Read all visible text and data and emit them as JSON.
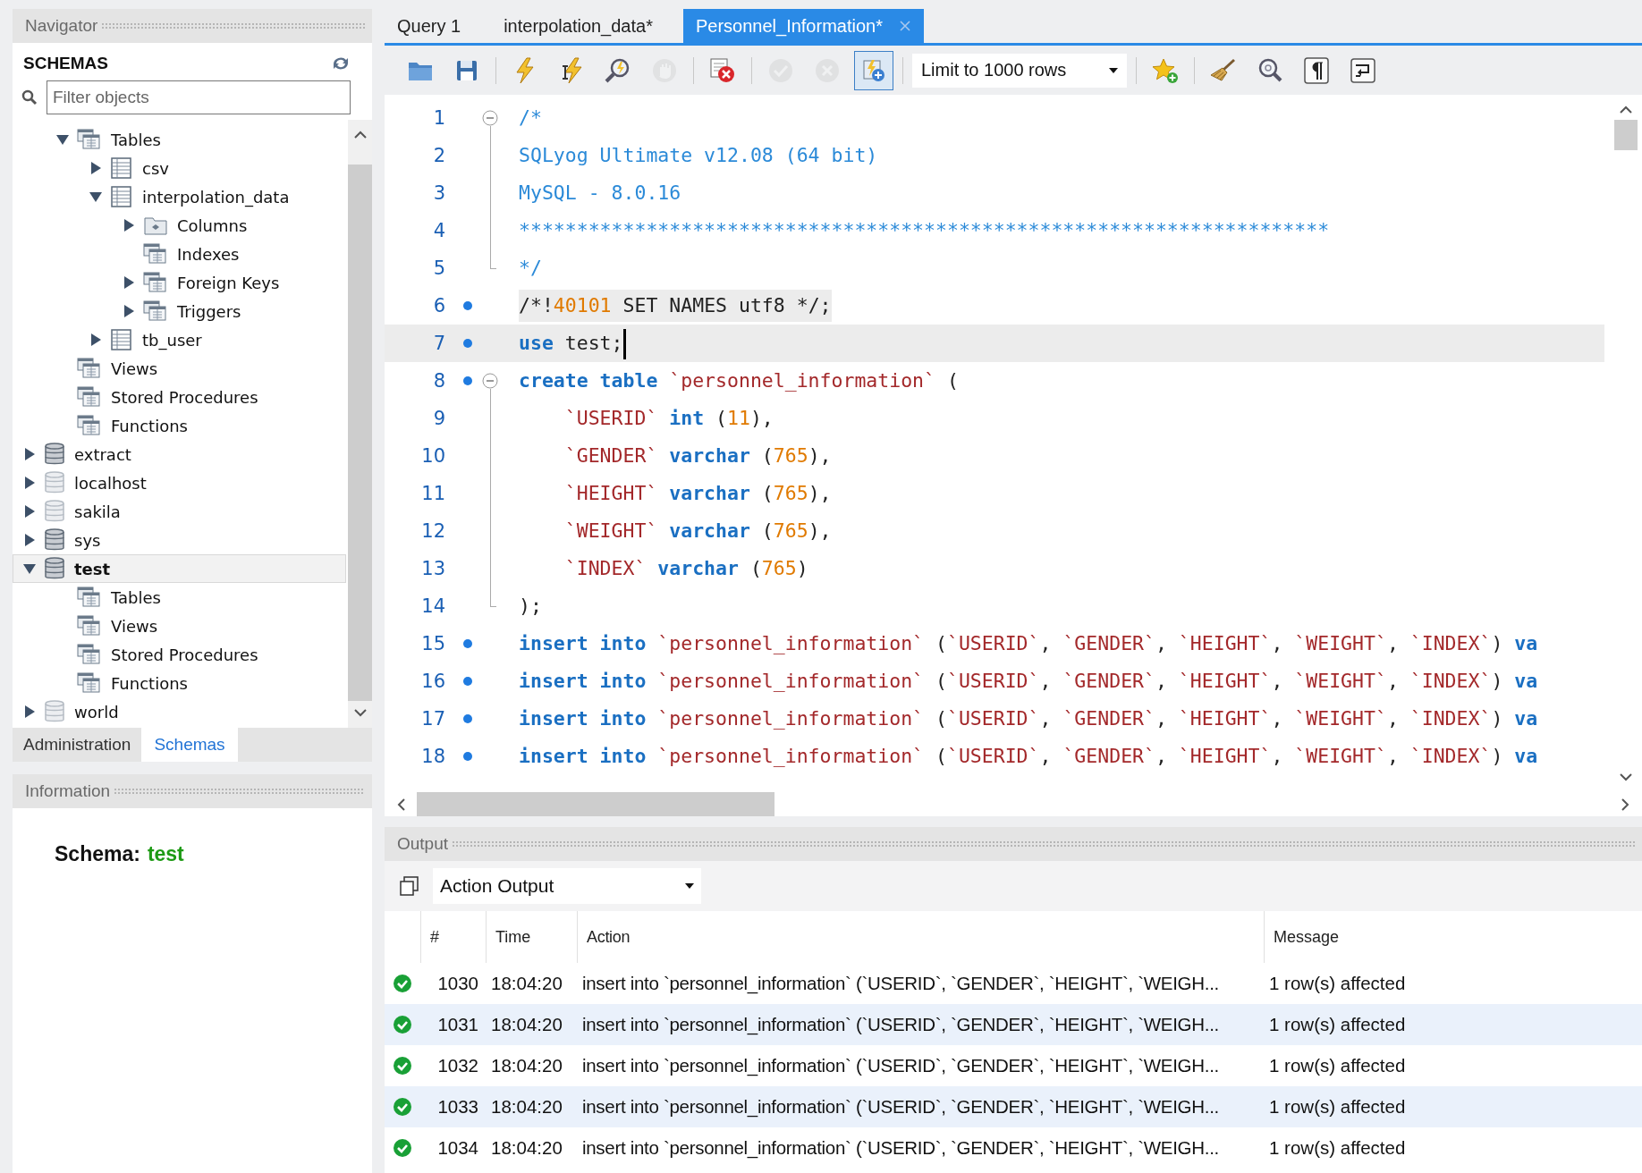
{
  "navigator": {
    "title": "Navigator",
    "heading": "SCHEMAS",
    "filter": {
      "placeholder": "Filter objects"
    },
    "tree": {
      "partial_children": [
        {
          "label": "Tables",
          "kind": "group",
          "expanded": true,
          "children": [
            {
              "label": "csv",
              "kind": "table",
              "expanded": false
            },
            {
              "label": "interpolation_data",
              "kind": "table",
              "expanded": true,
              "children": [
                {
                  "label": "Columns",
                  "kind": "columns",
                  "expanded": false
                },
                {
                  "label": "Indexes",
                  "kind": "group"
                },
                {
                  "label": "Foreign Keys",
                  "kind": "group",
                  "expanded": false
                },
                {
                  "label": "Triggers",
                  "kind": "group",
                  "expanded": false
                }
              ]
            },
            {
              "label": "tb_user",
              "kind": "table",
              "expanded": false
            }
          ]
        },
        {
          "label": "Views",
          "kind": "group"
        },
        {
          "label": "Stored Procedures",
          "kind": "group"
        },
        {
          "label": "Functions",
          "kind": "group"
        }
      ],
      "schemas": [
        {
          "label": "extract",
          "kind": "db",
          "expanded": false,
          "selected": false
        },
        {
          "label": "localhost",
          "kind": "db-light",
          "expanded": false,
          "selected": false
        },
        {
          "label": "sakila",
          "kind": "db-light",
          "expanded": false,
          "selected": false
        },
        {
          "label": "sys",
          "kind": "db",
          "expanded": false,
          "selected": false
        },
        {
          "label": "test",
          "kind": "db",
          "expanded": true,
          "selected": true,
          "children": [
            {
              "label": "Tables",
              "kind": "group"
            },
            {
              "label": "Views",
              "kind": "group"
            },
            {
              "label": "Stored Procedures",
              "kind": "group"
            },
            {
              "label": "Functions",
              "kind": "group"
            }
          ]
        },
        {
          "label": "world",
          "kind": "db-light",
          "expanded": false,
          "selected": false
        }
      ]
    },
    "tabs": [
      {
        "label": "Administration",
        "selected": false
      },
      {
        "label": "Schemas",
        "selected": true
      }
    ]
  },
  "information": {
    "title": "Information",
    "label": "Schema:",
    "value": "test"
  },
  "editor_tabs": [
    {
      "label": "Query 1",
      "selected": false
    },
    {
      "label": "interpolation_data*",
      "selected": false
    },
    {
      "label": "Personnel_Information*",
      "selected": true
    }
  ],
  "toolbar": [
    {
      "kind": "open",
      "disabled": false,
      "pressed": false
    },
    {
      "kind": "save",
      "disabled": false,
      "pressed": false
    },
    {
      "kind": "separator"
    },
    {
      "kind": "execute",
      "disabled": false,
      "pressed": false
    },
    {
      "kind": "execute-current",
      "disabled": false,
      "pressed": false
    },
    {
      "kind": "explain",
      "disabled": false,
      "pressed": false
    },
    {
      "kind": "stop",
      "disabled": true,
      "pressed": false
    },
    {
      "kind": "separator"
    },
    {
      "kind": "stop-on-error",
      "disabled": false,
      "pressed": false
    },
    {
      "kind": "separator"
    },
    {
      "kind": "commit",
      "disabled": true,
      "pressed": false
    },
    {
      "kind": "rollback",
      "disabled": true,
      "pressed": false
    },
    {
      "kind": "autocommit",
      "disabled": false,
      "pressed": true
    },
    {
      "kind": "separator"
    },
    {
      "kind": "limit",
      "label": "Limit to 1000 rows"
    },
    {
      "kind": "separator"
    },
    {
      "kind": "bookmark",
      "disabled": false,
      "pressed": false
    },
    {
      "kind": "separator"
    },
    {
      "kind": "beautify",
      "disabled": false,
      "pressed": false
    },
    {
      "kind": "find",
      "disabled": false,
      "pressed": false
    },
    {
      "kind": "invisibles",
      "disabled": false,
      "pressed": false
    },
    {
      "kind": "wrap",
      "disabled": false,
      "pressed": false
    }
  ],
  "code_lines": [
    {
      "n": "1",
      "kind": "fold-start",
      "dot": false,
      "current": false,
      "highlighted": false,
      "caret": false,
      "tokens": [
        {
          "kind": "comment",
          "text": "/*"
        }
      ]
    },
    {
      "n": "2",
      "kind": "fold-body",
      "dot": false,
      "current": false,
      "highlighted": false,
      "caret": false,
      "tokens": [
        {
          "kind": "comment",
          "text": "SQLyog Ultimate v12.08 (64 bit)"
        }
      ]
    },
    {
      "n": "3",
      "kind": "fold-body",
      "dot": false,
      "current": false,
      "highlighted": false,
      "caret": false,
      "tokens": [
        {
          "kind": "comment",
          "text": "MySQL - 8.0.16"
        }
      ]
    },
    {
      "n": "4",
      "kind": "fold-body",
      "dot": false,
      "current": false,
      "highlighted": false,
      "caret": false,
      "tokens": [
        {
          "kind": "comment",
          "text": "**********************************************************************"
        }
      ]
    },
    {
      "n": "5",
      "kind": "fold-end",
      "dot": false,
      "current": false,
      "highlighted": false,
      "caret": false,
      "tokens": [
        {
          "kind": "comment",
          "text": "*/"
        }
      ]
    },
    {
      "n": "6",
      "kind": "plain",
      "dot": true,
      "current": false,
      "highlighted": true,
      "caret": false,
      "tokens": [
        {
          "kind": "plain",
          "text": "/*!"
        },
        {
          "kind": "num",
          "text": "40101"
        },
        {
          "kind": "plain",
          "text": " SET NAMES utf8 */;"
        }
      ]
    },
    {
      "n": "7",
      "kind": "plain",
      "dot": true,
      "current": true,
      "highlighted": false,
      "caret": true,
      "tokens": [
        {
          "kind": "kw",
          "text": "use"
        },
        {
          "kind": "plain",
          "text": " test;"
        }
      ]
    },
    {
      "n": "8",
      "kind": "fold-start",
      "dot": true,
      "current": false,
      "highlighted": false,
      "caret": false,
      "tokens": [
        {
          "kind": "kw",
          "text": "create table"
        },
        {
          "kind": "ident",
          "text": " `personnel_information`"
        },
        {
          "kind": "plain",
          "text": " ("
        }
      ]
    },
    {
      "n": "9",
      "kind": "fold-body",
      "dot": false,
      "current": false,
      "highlighted": false,
      "caret": false,
      "tokens": [
        {
          "kind": "ident",
          "text": "    `USERID` "
        },
        {
          "kind": "kw",
          "text": "int"
        },
        {
          "kind": "plain",
          "text": " ("
        },
        {
          "kind": "num",
          "text": "11"
        },
        {
          "kind": "plain",
          "text": "),"
        }
      ]
    },
    {
      "n": "10",
      "kind": "fold-body",
      "dot": false,
      "current": false,
      "highlighted": false,
      "caret": false,
      "tokens": [
        {
          "kind": "ident",
          "text": "    `GENDER` "
        },
        {
          "kind": "kw",
          "text": "varchar"
        },
        {
          "kind": "plain",
          "text": " ("
        },
        {
          "kind": "num",
          "text": "765"
        },
        {
          "kind": "plain",
          "text": "),"
        }
      ]
    },
    {
      "n": "11",
      "kind": "fold-body",
      "dot": false,
      "current": false,
      "highlighted": false,
      "caret": false,
      "tokens": [
        {
          "kind": "ident",
          "text": "    `HEIGHT` "
        },
        {
          "kind": "kw",
          "text": "varchar"
        },
        {
          "kind": "plain",
          "text": " ("
        },
        {
          "kind": "num",
          "text": "765"
        },
        {
          "kind": "plain",
          "text": "),"
        }
      ]
    },
    {
      "n": "12",
      "kind": "fold-body",
      "dot": false,
      "current": false,
      "highlighted": false,
      "caret": false,
      "tokens": [
        {
          "kind": "ident",
          "text": "    `WEIGHT` "
        },
        {
          "kind": "kw",
          "text": "varchar"
        },
        {
          "kind": "plain",
          "text": " ("
        },
        {
          "kind": "num",
          "text": "765"
        },
        {
          "kind": "plain",
          "text": "),"
        }
      ]
    },
    {
      "n": "13",
      "kind": "fold-body",
      "dot": false,
      "current": false,
      "highlighted": false,
      "caret": false,
      "tokens": [
        {
          "kind": "ident",
          "text": "    `INDEX` "
        },
        {
          "kind": "kw",
          "text": "varchar"
        },
        {
          "kind": "plain",
          "text": " ("
        },
        {
          "kind": "num",
          "text": "765"
        },
        {
          "kind": "plain",
          "text": ")"
        }
      ]
    },
    {
      "n": "14",
      "kind": "fold-end",
      "dot": false,
      "current": false,
      "highlighted": false,
      "caret": false,
      "tokens": [
        {
          "kind": "plain",
          "text": ");"
        }
      ]
    },
    {
      "n": "15",
      "kind": "plain",
      "dot": true,
      "current": false,
      "highlighted": false,
      "caret": false,
      "tokens": [
        {
          "kind": "kw",
          "text": "insert into"
        },
        {
          "kind": "ident",
          "text": " `personnel_information`"
        },
        {
          "kind": "plain",
          "text": " ("
        },
        {
          "kind": "ident",
          "text": "`USERID`"
        },
        {
          "kind": "plain",
          "text": ", "
        },
        {
          "kind": "ident",
          "text": "`GENDER`"
        },
        {
          "kind": "plain",
          "text": ", "
        },
        {
          "kind": "ident",
          "text": "`HEIGHT`"
        },
        {
          "kind": "plain",
          "text": ", "
        },
        {
          "kind": "ident",
          "text": "`WEIGHT`"
        },
        {
          "kind": "plain",
          "text": ", "
        },
        {
          "kind": "ident",
          "text": "`INDEX`"
        },
        {
          "kind": "plain",
          "text": ") "
        },
        {
          "kind": "kw",
          "text": "va"
        }
      ]
    },
    {
      "n": "16",
      "kind": "plain",
      "dot": true,
      "current": false,
      "highlighted": false,
      "caret": false,
      "tokens": [
        {
          "kind": "kw",
          "text": "insert into"
        },
        {
          "kind": "ident",
          "text": " `personnel_information`"
        },
        {
          "kind": "plain",
          "text": " ("
        },
        {
          "kind": "ident",
          "text": "`USERID`"
        },
        {
          "kind": "plain",
          "text": ", "
        },
        {
          "kind": "ident",
          "text": "`GENDER`"
        },
        {
          "kind": "plain",
          "text": ", "
        },
        {
          "kind": "ident",
          "text": "`HEIGHT`"
        },
        {
          "kind": "plain",
          "text": ", "
        },
        {
          "kind": "ident",
          "text": "`WEIGHT`"
        },
        {
          "kind": "plain",
          "text": ", "
        },
        {
          "kind": "ident",
          "text": "`INDEX`"
        },
        {
          "kind": "plain",
          "text": ") "
        },
        {
          "kind": "kw",
          "text": "va"
        }
      ]
    },
    {
      "n": "17",
      "kind": "plain",
      "dot": true,
      "current": false,
      "highlighted": false,
      "caret": false,
      "tokens": [
        {
          "kind": "kw",
          "text": "insert into"
        },
        {
          "kind": "ident",
          "text": " `personnel_information`"
        },
        {
          "kind": "plain",
          "text": " ("
        },
        {
          "kind": "ident",
          "text": "`USERID`"
        },
        {
          "kind": "plain",
          "text": ", "
        },
        {
          "kind": "ident",
          "text": "`GENDER`"
        },
        {
          "kind": "plain",
          "text": ", "
        },
        {
          "kind": "ident",
          "text": "`HEIGHT`"
        },
        {
          "kind": "plain",
          "text": ", "
        },
        {
          "kind": "ident",
          "text": "`WEIGHT`"
        },
        {
          "kind": "plain",
          "text": ", "
        },
        {
          "kind": "ident",
          "text": "`INDEX`"
        },
        {
          "kind": "plain",
          "text": ") "
        },
        {
          "kind": "kw",
          "text": "va"
        }
      ]
    },
    {
      "n": "18",
      "kind": "plain",
      "dot": true,
      "current": false,
      "highlighted": false,
      "caret": false,
      "tokens": [
        {
          "kind": "kw",
          "text": "insert into"
        },
        {
          "kind": "ident",
          "text": " `personnel_information`"
        },
        {
          "kind": "plain",
          "text": " ("
        },
        {
          "kind": "ident",
          "text": "`USERID`"
        },
        {
          "kind": "plain",
          "text": ", "
        },
        {
          "kind": "ident",
          "text": "`GENDER`"
        },
        {
          "kind": "plain",
          "text": ", "
        },
        {
          "kind": "ident",
          "text": "`HEIGHT`"
        },
        {
          "kind": "plain",
          "text": ", "
        },
        {
          "kind": "ident",
          "text": "`WEIGHT`"
        },
        {
          "kind": "plain",
          "text": ", "
        },
        {
          "kind": "ident",
          "text": "`INDEX`"
        },
        {
          "kind": "plain",
          "text": ") "
        },
        {
          "kind": "kw",
          "text": "va"
        }
      ]
    }
  ],
  "output": {
    "title": "Output",
    "selector": "Action Output",
    "columns": [
      "#",
      "Time",
      "Action",
      "Message"
    ],
    "rows": [
      {
        "kind": "ok",
        "num": "1030",
        "time": "18:04:20",
        "action": "insert into `personnel_information` (`USERID`, `GENDER`, `HEIGHT`, `WEIGH...",
        "message": "1 row(s) affected"
      },
      {
        "kind": "ok",
        "num": "1031",
        "time": "18:04:20",
        "action": "insert into `personnel_information` (`USERID`, `GENDER`, `HEIGHT`, `WEIGH...",
        "message": "1 row(s) affected"
      },
      {
        "kind": "ok",
        "num": "1032",
        "time": "18:04:20",
        "action": "insert into `personnel_information` (`USERID`, `GENDER`, `HEIGHT`, `WEIGH...",
        "message": "1 row(s) affected"
      },
      {
        "kind": "ok",
        "num": "1033",
        "time": "18:04:20",
        "action": "insert into `personnel_information` (`USERID`, `GENDER`, `HEIGHT`, `WEIGH...",
        "message": "1 row(s) affected"
      },
      {
        "kind": "ok",
        "num": "1034",
        "time": "18:04:20",
        "action": "insert into `personnel_information` (`USERID`, `GENDER`, `HEIGHT`, `WEIGH...",
        "message": "1 row(s) affected"
      }
    ]
  }
}
